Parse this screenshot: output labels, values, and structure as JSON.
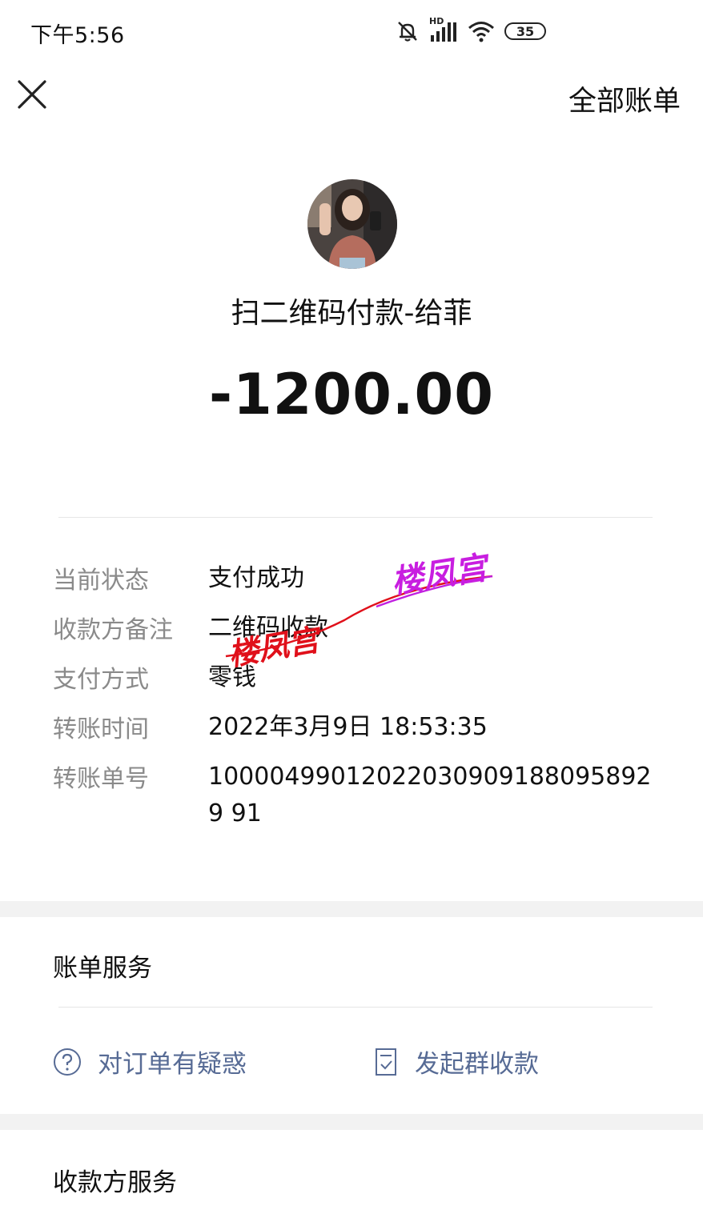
{
  "status_bar": {
    "time": "下午5:56",
    "signal_label": "HD",
    "battery": "35"
  },
  "header": {
    "all_bills": "全部账单"
  },
  "transaction": {
    "title": "扫二维码付款-给菲",
    "amount": "-1200.00"
  },
  "details": [
    {
      "label": "当前状态",
      "value": "支付成功"
    },
    {
      "label": "收款方备注",
      "value": "二维码收款"
    },
    {
      "label": "支付方式",
      "value": "零钱"
    },
    {
      "label": "转账时间",
      "value": "2022年3月9日 18:53:35"
    },
    {
      "label": "转账单号",
      "value": "100004990120220309091880958929 91"
    }
  ],
  "watermarks": [
    "楼凤宫",
    "楼凤宫"
  ],
  "bill_service": {
    "title": "账单服务",
    "items": [
      {
        "label": "对订单有疑惑",
        "icon": "question-circle-icon"
      },
      {
        "label": "发起群收款",
        "icon": "document-check-icon"
      }
    ]
  },
  "payee_service": {
    "title": "收款方服务"
  },
  "colors": {
    "link": "#576b95",
    "label": "#8a8a8a",
    "section_gap": "#f2f2f2"
  }
}
